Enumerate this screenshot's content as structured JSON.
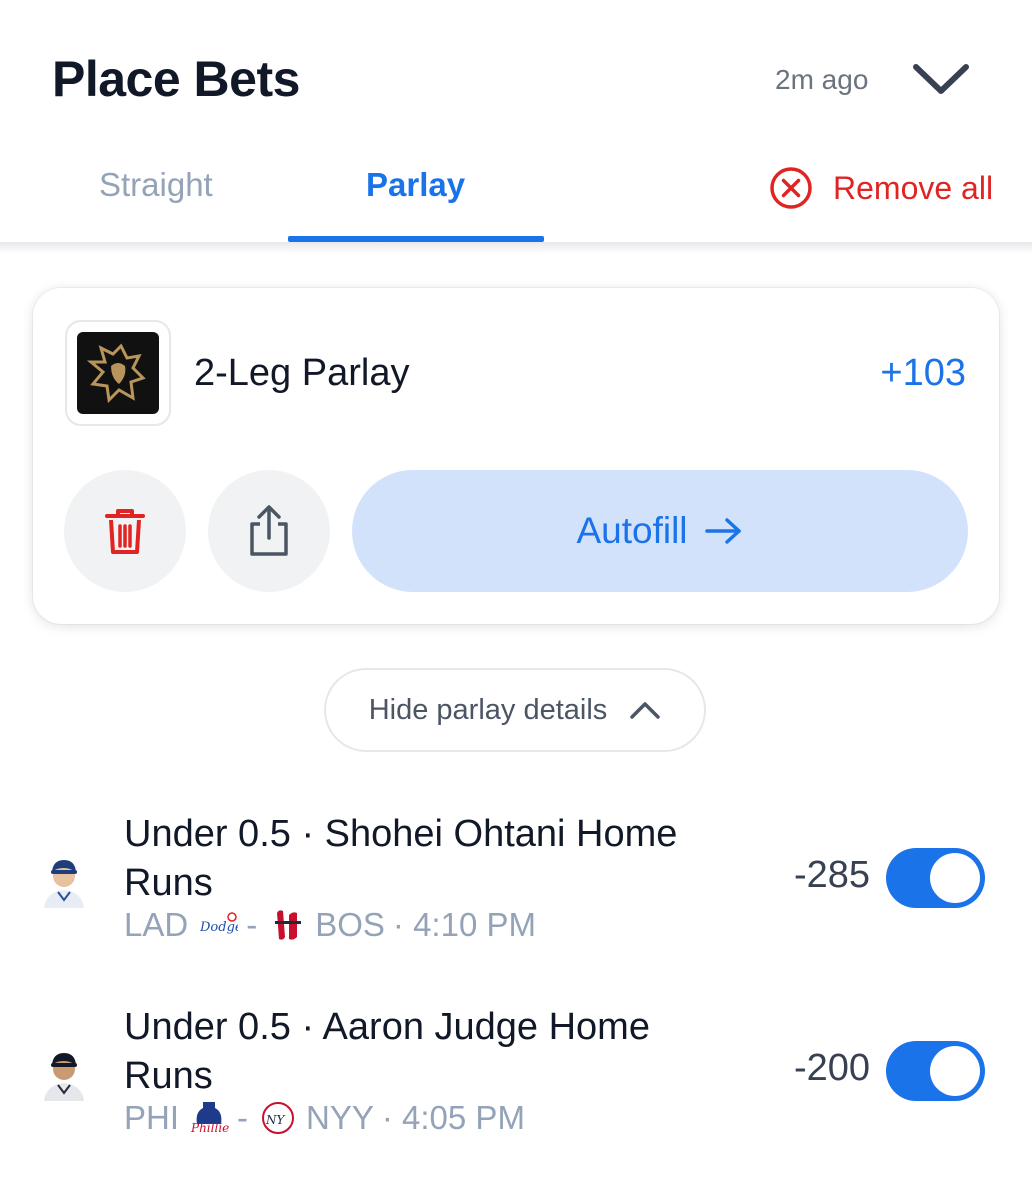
{
  "header": {
    "title": "Place Bets",
    "timestamp": "2m ago"
  },
  "tabs": [
    {
      "label": "Straight",
      "active": false
    },
    {
      "label": "Parlay",
      "active": true
    }
  ],
  "remove_all_label": "Remove all",
  "parlay": {
    "title": "2-Leg Parlay",
    "odds": "+103",
    "autofill_label": "Autofill"
  },
  "details_toggle_label": "Hide parlay details",
  "legs": [
    {
      "title": "Under 0.5 · Shohei Ohtani Home Runs",
      "away_team": "LAD",
      "separator": "-",
      "home_team": "BOS",
      "time": "· 4:10 PM",
      "odds": "-285",
      "selected": true
    },
    {
      "title": "Under 0.5 · Aaron Judge Home Runs",
      "away_team": "PHI",
      "separator": "-",
      "home_team": "NYY",
      "time": "· 4:05 PM",
      "odds": "-200",
      "selected": true
    }
  ],
  "colors": {
    "accent": "#1a73e8",
    "danger": "#e02424",
    "muted": "#94a3b8",
    "autofill_bg": "#d3e2fb"
  }
}
